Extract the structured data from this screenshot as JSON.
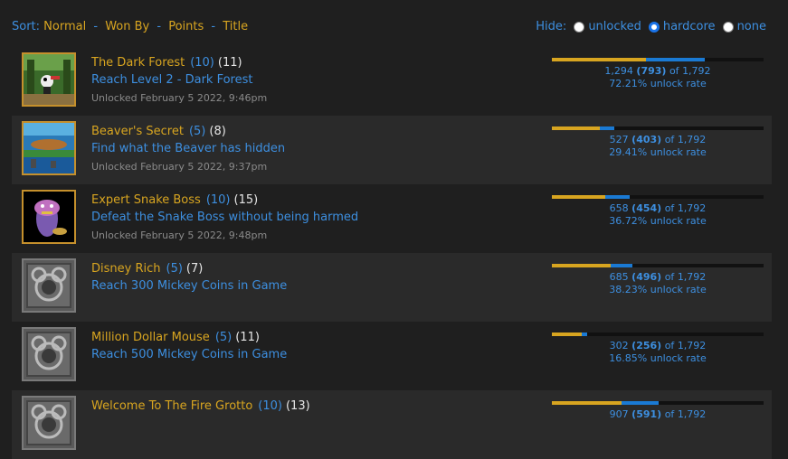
{
  "sort": {
    "label": "Sort:",
    "options": [
      "Normal",
      "Won By",
      "Points",
      "Title"
    ],
    "separator": "-"
  },
  "hide": {
    "label": "Hide:",
    "options": [
      {
        "label": "unlocked",
        "checked": false
      },
      {
        "label": "hardcore",
        "checked": true
      },
      {
        "label": "none",
        "checked": false
      }
    ]
  },
  "colors": {
    "gold": "#d8a520",
    "blue": "#3d8fe0",
    "bar_blue": "#1a7ad4"
  },
  "achievements": [
    {
      "title": "The Dark Forest",
      "points": "(10)",
      "true_points": "(11)",
      "description": "Reach Level 2 - Dark Forest",
      "unlocked": "Unlocked February 5 2022, 9:46pm",
      "badge": "dark-forest-badge",
      "locked": false,
      "softcore_total": "1,294",
      "hardcore_total": "(793)",
      "of": "of",
      "players": "1,792",
      "rate": "72.21% unlock rate",
      "hardcore_fraction": 0.4425,
      "total_fraction": 0.7221
    },
    {
      "title": "Beaver's Secret",
      "points": "(5)",
      "true_points": "(8)",
      "description": "Find what the Beaver has hidden",
      "unlocked": "Unlocked February 5 2022, 9:37pm",
      "badge": "beaver-badge",
      "locked": false,
      "softcore_total": "527",
      "hardcore_total": "(403)",
      "of": "of",
      "players": "1,792",
      "rate": "29.41% unlock rate",
      "hardcore_fraction": 0.2249,
      "total_fraction": 0.2941
    },
    {
      "title": "Expert Snake Boss",
      "points": "(10)",
      "true_points": "(15)",
      "description": "Defeat the Snake Boss without being harmed",
      "unlocked": "Unlocked February 5 2022, 9:48pm",
      "badge": "snake-badge",
      "locked": false,
      "softcore_total": "658",
      "hardcore_total": "(454)",
      "of": "of",
      "players": "1,792",
      "rate": "36.72% unlock rate",
      "hardcore_fraction": 0.2533,
      "total_fraction": 0.3672
    },
    {
      "title": "Disney Rich",
      "points": "(5)",
      "true_points": "(7)",
      "description": "Reach 300 Mickey Coins in Game",
      "unlocked": "",
      "badge": "mickey-locked-badge",
      "locked": true,
      "softcore_total": "685",
      "hardcore_total": "(496)",
      "of": "of",
      "players": "1,792",
      "rate": "38.23% unlock rate",
      "hardcore_fraction": 0.2768,
      "total_fraction": 0.3823
    },
    {
      "title": "Million Dollar Mouse",
      "points": "(5)",
      "true_points": "(11)",
      "description": "Reach 500 Mickey Coins in Game",
      "unlocked": "",
      "badge": "mickey-locked-badge",
      "locked": true,
      "softcore_total": "302",
      "hardcore_total": "(256)",
      "of": "of",
      "players": "1,792",
      "rate": "16.85% unlock rate",
      "hardcore_fraction": 0.1429,
      "total_fraction": 0.1685
    },
    {
      "title": "Welcome To The Fire Grotto",
      "points": "(10)",
      "true_points": "(13)",
      "description": "",
      "unlocked": "",
      "badge": "mickey-locked-badge",
      "locked": true,
      "softcore_total": "907",
      "hardcore_total": "(591)",
      "of": "of",
      "players": "1,792",
      "rate": "",
      "hardcore_fraction": 0.3298,
      "total_fraction": 0.5061
    }
  ]
}
